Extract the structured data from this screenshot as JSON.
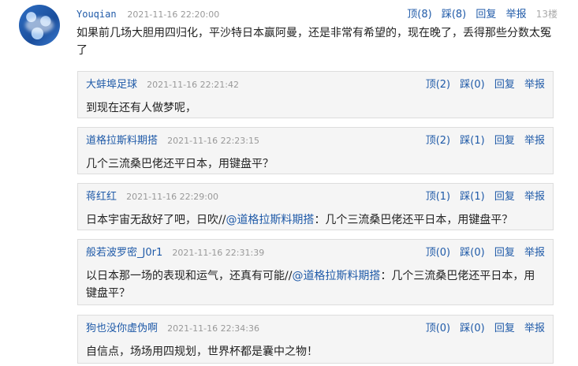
{
  "main_comment": {
    "username": "Youqian",
    "timestamp": "2021-11-16 22:20:00",
    "up_label": "顶(8)",
    "down_label": "踩(8)",
    "reply_label": "回复",
    "report_label": "举报",
    "floor": "13楼",
    "text": "如果前几场大胆用四归化，平沙特日本赢阿曼，还是非常有希望的，现在晚了，丢得那些分数太冤了"
  },
  "replies": [
    {
      "username": "大蚌埠足球",
      "timestamp": "2021-11-16 22:21:42",
      "up_label": "顶(2)",
      "down_label": "踩(0)",
      "reply_label": "回复",
      "report_label": "举报",
      "text": "到现在还有人做梦呢，",
      "mention": "",
      "text_after": ""
    },
    {
      "username": "道格拉斯料期搭",
      "timestamp": "2021-11-16 22:23:15",
      "up_label": "顶(2)",
      "down_label": "踩(1)",
      "reply_label": "回复",
      "report_label": "举报",
      "text": "几个三流桑巴佬还平日本，用键盘平？",
      "mention": "",
      "text_after": ""
    },
    {
      "username": "蒋红红",
      "timestamp": "2021-11-16 22:29:00",
      "up_label": "顶(1)",
      "down_label": "踩(1)",
      "reply_label": "回复",
      "report_label": "举报",
      "text": "日本宇宙无敌好了吧，日吹//",
      "mention": "@道格拉斯料期搭",
      "text_after": "：几个三流桑巴佬还平日本，用键盘平？"
    },
    {
      "username": "般若波罗密_J0r1",
      "timestamp": "2021-11-16 22:31:39",
      "up_label": "顶(0)",
      "down_label": "踩(0)",
      "reply_label": "回复",
      "report_label": "举报",
      "text": "以日本那一场的表现和运气，还真有可能//",
      "mention": "@道格拉斯料期搭",
      "text_after": "：几个三流桑巴佬还平日本，用键盘平？"
    },
    {
      "username": "狗也没你虚伪啊",
      "timestamp": "2021-11-16 22:34:36",
      "up_label": "顶(0)",
      "down_label": "踩(0)",
      "reply_label": "回复",
      "report_label": "举报",
      "text": "自信点，场场用四规划，世界杯都是囊中之物！",
      "mention": "",
      "text_after": ""
    }
  ]
}
